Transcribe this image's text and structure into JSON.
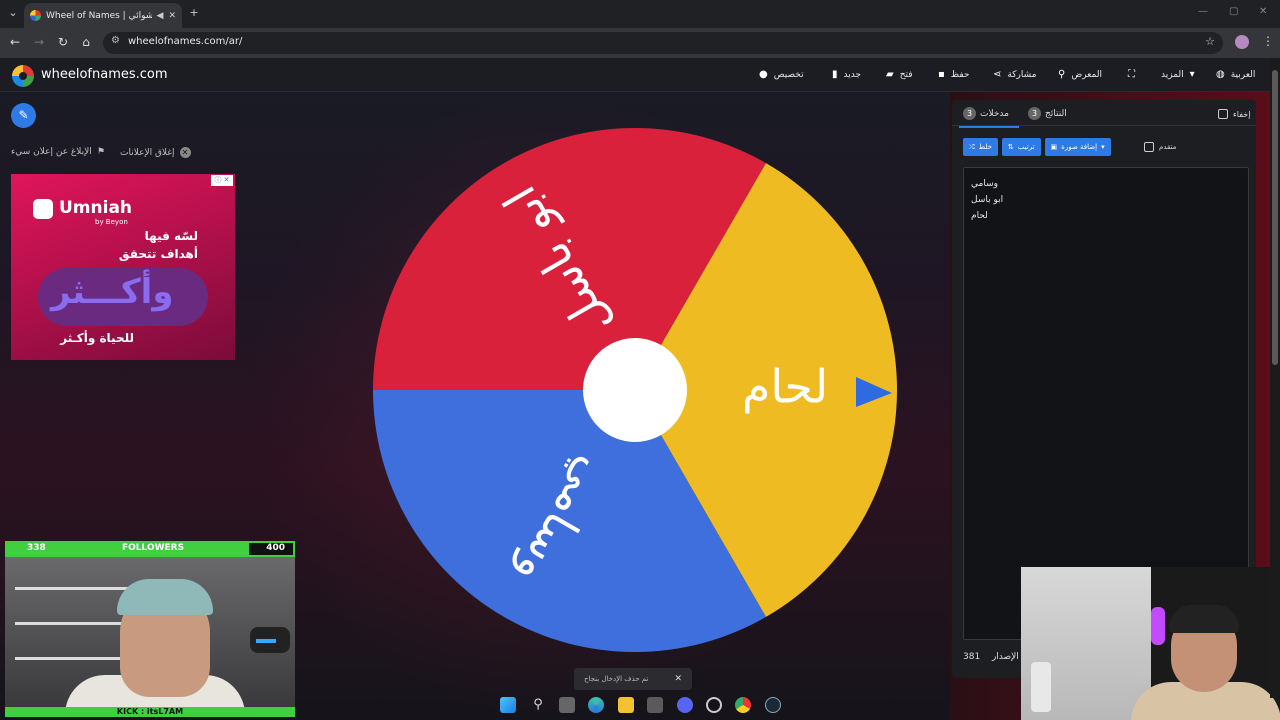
{
  "browser": {
    "tab_title": "Wheel of Names | العشوائي",
    "url": "wheelofnames.com/ar/"
  },
  "app": {
    "brand": "wheelofnames.com",
    "menu": {
      "language": "العربية",
      "more": "المزيد",
      "gallery": "المعرض",
      "share": "مشاركة",
      "save": "حفظ",
      "open": "فتح",
      "new": "جديد",
      "customize": "تخصيص"
    }
  },
  "ads": {
    "close_ads": "إغلاق الإعلانات",
    "report_ad": "الإبلاغ عن إعلان سيء",
    "brand": "Umniah",
    "brand_sub": "by Beyon",
    "line1": "لسّه فيها",
    "line2": "أهداف تتحقق",
    "big": "وأكـــثر",
    "line3": "للحياة وأكـثر"
  },
  "wheel": {
    "segments": [
      {
        "label": "ابو باسل",
        "color": "#d9213c"
      },
      {
        "label": "وسامي",
        "color": "#3e6fdc"
      },
      {
        "label": "لحام",
        "color": "#efbb22"
      }
    ]
  },
  "panel": {
    "tab_entries": "مدخلات",
    "tab_entries_count": "3",
    "tab_results": "النتائج",
    "tab_results_count": "3",
    "hide_label": "إخفاء",
    "shuffle": "خلط",
    "sort": "ترتيب",
    "add_image": "إضافة صورة",
    "advanced": "متقدم",
    "entries": [
      "وسامي",
      "ابو باسل",
      "لحام"
    ],
    "version_label": "الإصدار",
    "version_number": "381"
  },
  "toast": {
    "message": "تم حذف الإدخال بنجاح"
  },
  "overlay": {
    "followers_current": "338",
    "followers_label": "FOLLOWERS",
    "followers_goal": "400",
    "followers_progress": 0.845,
    "kick": "KICK : itsL7AM"
  }
}
